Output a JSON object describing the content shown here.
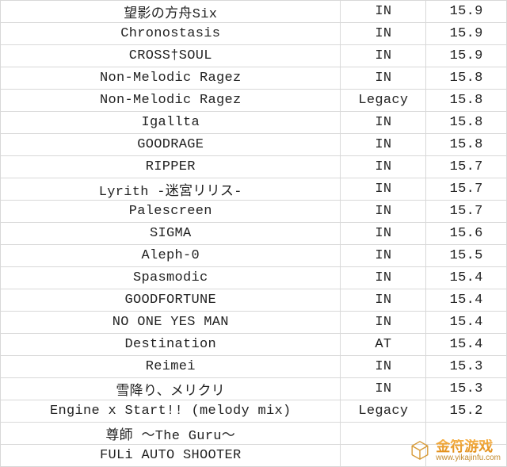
{
  "chart_data": {
    "type": "table",
    "columns": [
      "song",
      "difficulty",
      "rating"
    ],
    "rows": [
      {
        "song": "望影の方舟Six",
        "difficulty": "IN",
        "rating": "15.9"
      },
      {
        "song": "Chronostasis",
        "difficulty": "IN",
        "rating": "15.9"
      },
      {
        "song": "CROSS†SOUL",
        "difficulty": "IN",
        "rating": "15.9"
      },
      {
        "song": "Non-Melodic Ragez",
        "difficulty": "IN",
        "rating": "15.8"
      },
      {
        "song": "Non-Melodic Ragez",
        "difficulty": "Legacy",
        "rating": "15.8"
      },
      {
        "song": "Igallta",
        "difficulty": "IN",
        "rating": "15.8"
      },
      {
        "song": "GOODRAGE",
        "difficulty": "IN",
        "rating": "15.8"
      },
      {
        "song": "RIPPER",
        "difficulty": "IN",
        "rating": "15.7"
      },
      {
        "song": "Lyrith -迷宮リリス-",
        "difficulty": "IN",
        "rating": "15.7"
      },
      {
        "song": "Palescreen",
        "difficulty": "IN",
        "rating": "15.7"
      },
      {
        "song": "SIGMA",
        "difficulty": "IN",
        "rating": "15.6"
      },
      {
        "song": "Aleph-0",
        "difficulty": "IN",
        "rating": "15.5"
      },
      {
        "song": "Spasmodic",
        "difficulty": "IN",
        "rating": "15.4"
      },
      {
        "song": "GOODFORTUNE",
        "difficulty": "IN",
        "rating": "15.4"
      },
      {
        "song": "NO ONE YES MAN",
        "difficulty": "IN",
        "rating": "15.4"
      },
      {
        "song": "Destination",
        "difficulty": "AT",
        "rating": "15.4"
      },
      {
        "song": "Reimei",
        "difficulty": "IN",
        "rating": "15.3"
      },
      {
        "song": "雪降り、メリクリ",
        "difficulty": "IN",
        "rating": "15.3"
      },
      {
        "song": "Engine x Start!! (melody mix)",
        "difficulty": "Legacy",
        "rating": "15.2"
      },
      {
        "song": "尊師 ～The Guru～",
        "difficulty": "",
        "rating": ""
      },
      {
        "song": "FULi AUTO SHOOTER",
        "difficulty": "",
        "rating": ""
      }
    ]
  },
  "watermark": {
    "brand": "金符游戏",
    "url": "www.yikajinfu.com"
  }
}
